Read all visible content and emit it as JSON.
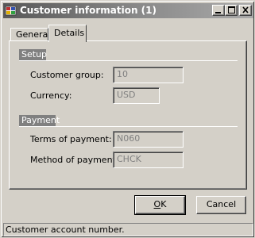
{
  "window": {
    "title": "Customer information (1)"
  },
  "tabs": [
    {
      "label": "General",
      "active": false
    },
    {
      "label": "Details",
      "active": true
    }
  ],
  "setup": {
    "header": "Setup",
    "customer_group": {
      "label": "Customer group:",
      "value": "10"
    },
    "currency": {
      "label": "Currency:",
      "value": "USD"
    }
  },
  "payment": {
    "header": "Payment",
    "terms": {
      "label": "Terms of payment:",
      "value": "N060"
    },
    "method": {
      "label": "Method of payment:",
      "value": "CHCK"
    }
  },
  "buttons": {
    "ok_mnemonic": "O",
    "ok_rest": "K",
    "cancel": "Cancel"
  },
  "status": {
    "text": "Customer account number."
  },
  "icons": {
    "app": "app-icon",
    "minimize": "minimize-icon",
    "maximize": "maximize-icon",
    "close": "close-icon"
  },
  "colors": {
    "titlebar_start": "#585858",
    "titlebar_end": "#a9a9a9",
    "face": "#d4d0c8",
    "group_header": "#808080"
  }
}
